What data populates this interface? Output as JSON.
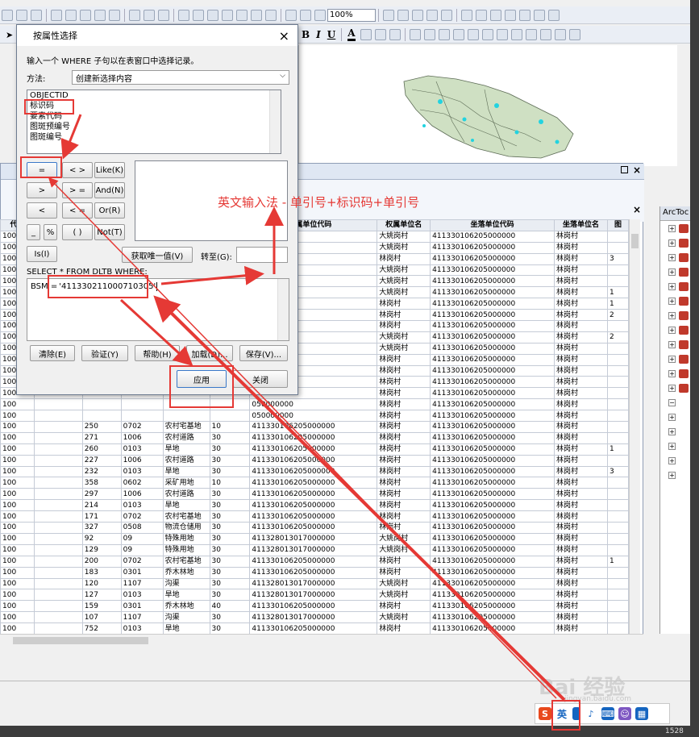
{
  "toolbar": {
    "zoom": "100%"
  },
  "attr_window": {
    "close_label": "×"
  },
  "toc": {
    "title": "ArcToc",
    "rows": 18
  },
  "table": {
    "columns": [
      "代码",
      "",
      "",
      "",
      "",
      "",
      "属单位代码",
      "权属单位名",
      "坐落单位代码",
      "坐落单位名",
      "图"
    ],
    "rows": [
      [
        "100",
        "",
        "",
        "",
        "",
        "",
        "170000000",
        "大姚岗村",
        "411330106205000000",
        "林岗村",
        ""
      ],
      [
        "100",
        "",
        "",
        "",
        "",
        "",
        "170000000",
        "大姚岗村",
        "411330106205000000",
        "林岗村",
        ""
      ],
      [
        "100",
        "",
        "",
        "",
        "",
        "",
        "050000000",
        "林岗村",
        "411330106205000000",
        "林岗村",
        "3"
      ],
      [
        "100",
        "",
        "",
        "",
        "",
        "",
        "170000000",
        "大姚岗村",
        "411330106205000000",
        "林岗村",
        ""
      ],
      [
        "100",
        "",
        "",
        "",
        "",
        "",
        "170000000",
        "大姚岗村",
        "411330106205000000",
        "林岗村",
        ""
      ],
      [
        "100",
        "",
        "",
        "",
        "",
        "",
        "170000000",
        "大姚岗村",
        "411330106205000000",
        "林岗村",
        "1"
      ],
      [
        "100",
        "",
        "",
        "",
        "",
        "",
        "050000000",
        "林岗村",
        "411330106205000000",
        "林岗村",
        "1"
      ],
      [
        "100",
        "",
        "",
        "",
        "",
        "",
        "050000000",
        "林岗村",
        "411330106205000000",
        "林岗村",
        "2"
      ],
      [
        "100",
        "",
        "",
        "",
        "",
        "",
        "050000000",
        "林岗村",
        "411330106205000000",
        "林岗村",
        ""
      ],
      [
        "100",
        "",
        "",
        "",
        "",
        "",
        "170000000",
        "大姚岗村",
        "411330106205000000",
        "林岗村",
        "2"
      ],
      [
        "100",
        "",
        "",
        "",
        "",
        "",
        "170000000",
        "大姚岗村",
        "411330106205000000",
        "林岗村",
        ""
      ],
      [
        "100",
        "",
        "",
        "",
        "",
        "",
        "050000000",
        "林岗村",
        "411330106205000000",
        "林岗村",
        ""
      ],
      [
        "100",
        "",
        "",
        "",
        "",
        "",
        "050000000",
        "林岗村",
        "411330106205000000",
        "林岗村",
        ""
      ],
      [
        "100",
        "",
        "",
        "",
        "",
        "",
        "050000000",
        "林岗村",
        "411330106205000000",
        "林岗村",
        ""
      ],
      [
        "100",
        "",
        "",
        "",
        "",
        "",
        "050000000",
        "林岗村",
        "411330106205000000",
        "林岗村",
        ""
      ],
      [
        "100",
        "",
        "",
        "",
        "",
        "",
        "050000000",
        "林岗村",
        "411330106205000000",
        "林岗村",
        ""
      ],
      [
        "100",
        "",
        "",
        "",
        "",
        "",
        "050000000",
        "林岗村",
        "411330106205000000",
        "林岗村",
        ""
      ],
      [
        "100",
        "",
        "250",
        "0702",
        "农村宅基地",
        "10",
        "411330106205000000",
        "林岗村",
        "411330106205000000",
        "林岗村",
        ""
      ],
      [
        "100",
        "",
        "271",
        "1006",
        "农村道路",
        "30",
        "411330106205000000",
        "林岗村",
        "411330106205000000",
        "林岗村",
        ""
      ],
      [
        "100",
        "",
        "260",
        "0103",
        "旱地",
        "30",
        "411330106205000000",
        "林岗村",
        "411330106205000000",
        "林岗村",
        "1"
      ],
      [
        "100",
        "",
        "227",
        "1006",
        "农村道路",
        "30",
        "411330106205000000",
        "林岗村",
        "411330106205000000",
        "林岗村",
        ""
      ],
      [
        "100",
        "",
        "232",
        "0103",
        "旱地",
        "30",
        "411330106205000000",
        "林岗村",
        "411330106205000000",
        "林岗村",
        "3"
      ],
      [
        "100",
        "",
        "358",
        "0602",
        "采矿用地",
        "10",
        "411330106205000000",
        "林岗村",
        "411330106205000000",
        "林岗村",
        ""
      ],
      [
        "100",
        "",
        "297",
        "1006",
        "农村道路",
        "30",
        "411330106205000000",
        "林岗村",
        "411330106205000000",
        "林岗村",
        ""
      ],
      [
        "100",
        "",
        "214",
        "0103",
        "旱地",
        "30",
        "411330106205000000",
        "林岗村",
        "411330106205000000",
        "林岗村",
        ""
      ],
      [
        "100",
        "",
        "171",
        "0702",
        "农村宅基地",
        "30",
        "411330106205000000",
        "林岗村",
        "411330106205000000",
        "林岗村",
        ""
      ],
      [
        "100",
        "",
        "327",
        "0508",
        "物流仓储用",
        "30",
        "411330106205000000",
        "林岗村",
        "411330106205000000",
        "林岗村",
        ""
      ],
      [
        "100",
        "",
        "92",
        "09",
        "特殊用地",
        "30",
        "411328013017000000",
        "大姚岗村",
        "411330106205000000",
        "林岗村",
        ""
      ],
      [
        "100",
        "",
        "129",
        "09",
        "特殊用地",
        "30",
        "411328013017000000",
        "大姚岗村",
        "411330106205000000",
        "林岗村",
        ""
      ],
      [
        "100",
        "",
        "200",
        "0702",
        "农村宅基地",
        "30",
        "411330106205000000",
        "林岗村",
        "411330106205000000",
        "林岗村",
        "1"
      ],
      [
        "100",
        "",
        "183",
        "0301",
        "乔木林地",
        "30",
        "411330106205000000",
        "林岗村",
        "411330106205000000",
        "林岗村",
        ""
      ],
      [
        "100",
        "",
        "120",
        "1107",
        "沟渠",
        "30",
        "411328013017000000",
        "大姚岗村",
        "411330106205000000",
        "林岗村",
        ""
      ],
      [
        "100",
        "",
        "127",
        "0103",
        "旱地",
        "30",
        "411328013017000000",
        "大姚岗村",
        "411330106205000000",
        "林岗村",
        ""
      ],
      [
        "100",
        "",
        "159",
        "0301",
        "乔木林地",
        "40",
        "411330106205000000",
        "林岗村",
        "411330106205000000",
        "林岗村",
        ""
      ],
      [
        "100",
        "",
        "107",
        "1107",
        "沟渠",
        "30",
        "411328013017000000",
        "大姚岗村",
        "411330106205000000",
        "林岗村",
        ""
      ],
      [
        "100",
        "",
        "752",
        "0103",
        "旱地",
        "30",
        "411330106205000000",
        "林岗村",
        "411330106205000000",
        "林岗村",
        ""
      ],
      [
        "100",
        "",
        "230",
        "09",
        "特殊用地",
        "30",
        "411330106205000000",
        "林岗村",
        "411330106205000000",
        "林岗村",
        ""
      ],
      [
        "100",
        "",
        "359",
        "1006",
        "农村道路",
        "30",
        "411330106205000000",
        "林岗村",
        "411330106205000000",
        "林岗村",
        ""
      ],
      [
        "100",
        "",
        "97",
        "0103",
        "旱地",
        "30",
        "411328013017000000",
        "大姚岗村",
        "411330106205000000",
        "林岗村",
        ""
      ]
    ]
  },
  "dialog": {
    "title": "按属性选择",
    "close": "×",
    "instruction": "输入一个 WHERE 子句以在表窗口中选择记录。",
    "method_label": "方法:",
    "method_value": "创建新选择内容",
    "fields": [
      "OBJECTID",
      "标识码",
      "要素代码",
      "图斑预编号",
      "图斑编号"
    ],
    "operators": {
      "eq": "=",
      "ne": "< >",
      "like": "Like(K)",
      "gt": ">",
      "ge": "> =",
      "and": "And(N)",
      "lt": "<",
      "le": "< =",
      "or": "Or(R)",
      "us": "_",
      "pct": "%",
      "paren": "( )",
      "not": "Not(T)",
      "is": "Is(I)"
    },
    "get_unique": "获取唯一值(V)",
    "goto_label": "转至(G):",
    "sql_prefix": "SELECT * FROM DLTB WHERE:",
    "expression_field": "BSM =",
    "expression_value": "'411330211000710305'",
    "buttons": {
      "clear": "清除(E)",
      "verify": "验证(Y)",
      "help": "帮助(H)",
      "load": "加载(D)...",
      "save": "保存(V)...",
      "apply": "应用",
      "close": "关闭"
    }
  },
  "annotation": {
    "text": "英文输入法 - 单引号+标识码+单引号",
    "color": "#e53935"
  },
  "taskbar": {
    "ime_label": "英",
    "baidu_label": "du",
    "watermark": "Bai 经验",
    "watermark_sub": "jingyan.baidu.com",
    "corner_number": "1528"
  }
}
